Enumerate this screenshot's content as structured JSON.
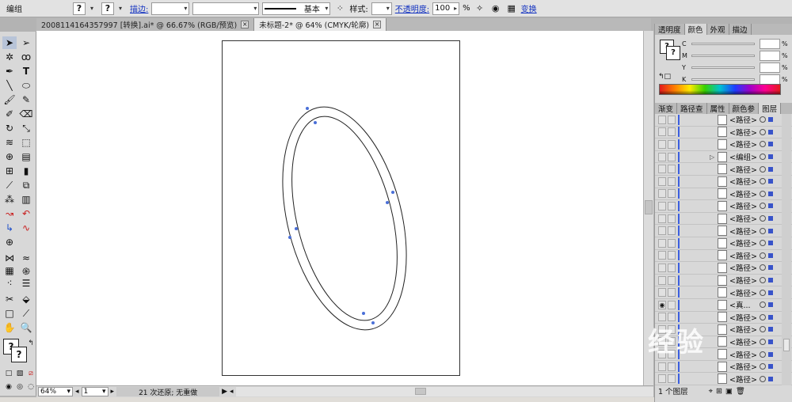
{
  "control_bar": {
    "mode_label": "编组",
    "stroke_link": "描边:",
    "stroke_value": "",
    "brush_value": "基本",
    "style_label": "样式:",
    "opacity_link": "不透明度:",
    "opacity_value": "100",
    "opacity_unit": "%",
    "transform_link": "变换"
  },
  "tabs": [
    {
      "label": "2008114164357997 [转换].ai* @ 66.67% (RGB/预览)"
    },
    {
      "label": "未标题-2* @ 64% (CMYK/轮廓)"
    }
  ],
  "panels": {
    "top_tabs": [
      "透明度",
      "颜色",
      "外观",
      "描边"
    ],
    "active_top_tab": "颜色",
    "channels": [
      {
        "label": "C",
        "unit": "%"
      },
      {
        "label": "M",
        "unit": "%"
      },
      {
        "label": "Y",
        "unit": "%"
      },
      {
        "label": "K",
        "unit": "%"
      }
    ],
    "lower_tabs": [
      "渐变",
      "路径查",
      "属性",
      "颜色参",
      "图层"
    ],
    "active_lower_tab": "图层",
    "layers": [
      {
        "name": "<路径>",
        "group": false,
        "visible": false
      },
      {
        "name": "<路径>",
        "group": false,
        "visible": false
      },
      {
        "name": "<路径>",
        "group": false,
        "visible": false
      },
      {
        "name": "<编组>",
        "group": true,
        "visible": false
      },
      {
        "name": "<路径>",
        "group": false,
        "visible": false
      },
      {
        "name": "<路径>",
        "group": false,
        "visible": false
      },
      {
        "name": "<路径>",
        "group": false,
        "visible": false
      },
      {
        "name": "<路径>",
        "group": false,
        "visible": false
      },
      {
        "name": "<路径>",
        "group": false,
        "visible": false
      },
      {
        "name": "<路径>",
        "group": false,
        "visible": false
      },
      {
        "name": "<路径>",
        "group": false,
        "visible": false
      },
      {
        "name": "<路径>",
        "group": false,
        "visible": false
      },
      {
        "name": "<路径>",
        "group": false,
        "visible": false
      },
      {
        "name": "<路径>",
        "group": false,
        "visible": false
      },
      {
        "name": "<路径>",
        "group": false,
        "visible": false
      },
      {
        "name": "<真...",
        "group": false,
        "visible": true
      },
      {
        "name": "<路径>",
        "group": false,
        "visible": false
      },
      {
        "name": "<路径>",
        "group": false,
        "visible": false
      },
      {
        "name": "<路径>",
        "group": false,
        "visible": false
      },
      {
        "name": "<路径>",
        "group": false,
        "visible": false
      },
      {
        "name": "<路径>",
        "group": false,
        "visible": false
      },
      {
        "name": "<路径>",
        "group": false,
        "visible": false
      }
    ],
    "footer": "1 个图层"
  },
  "status": {
    "zoom": "64%",
    "page": "1",
    "message": "21 次还原; 无重做"
  },
  "watermark": "经验"
}
